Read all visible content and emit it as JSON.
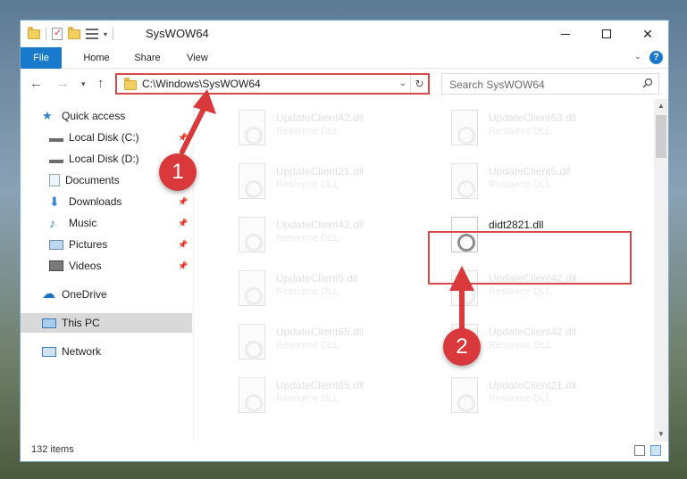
{
  "window": {
    "title": "SysWOW64",
    "caption_buttons": {
      "minimize": "—",
      "maximize": "☐",
      "close": "✕"
    }
  },
  "ribbon": {
    "tabs": [
      "File",
      "Home",
      "Share",
      "View"
    ],
    "help": "?"
  },
  "nav": {
    "address": "C:\\Windows\\SysWOW64",
    "search_placeholder": "Search SysWOW64"
  },
  "sidebar": {
    "items": [
      {
        "label": "Quick access",
        "icon": "star-icon",
        "pinned": false
      },
      {
        "label": "Local Disk (C:)",
        "icon": "drive-icon",
        "pinned": true
      },
      {
        "label": "Local Disk (D:)",
        "icon": "drive-icon",
        "pinned": true
      },
      {
        "label": "Documents",
        "icon": "documents-icon",
        "pinned": true
      },
      {
        "label": "Downloads",
        "icon": "downloads-icon",
        "pinned": true
      },
      {
        "label": "Music",
        "icon": "music-icon",
        "pinned": true
      },
      {
        "label": "Pictures",
        "icon": "pictures-icon",
        "pinned": true
      },
      {
        "label": "Videos",
        "icon": "videos-icon",
        "pinned": true
      },
      {
        "label": "OneDrive",
        "icon": "onedrive-icon",
        "pinned": false
      },
      {
        "label": "This PC",
        "icon": "pc-icon",
        "pinned": false,
        "selected": true
      },
      {
        "label": "Network",
        "icon": "network-icon",
        "pinned": false
      }
    ]
  },
  "files": [
    {
      "name": "UpdateClient42.dll",
      "type": "Resource DLL"
    },
    {
      "name": "UpdateClient63.dll",
      "type": "Resource DLL"
    },
    {
      "name": "UpdateClient21.dll",
      "type": "Resource DLL"
    },
    {
      "name": "UpdateClient5.dll",
      "type": "Resource DLL"
    },
    {
      "name": "UpdateClient42.dll",
      "type": "Resource DLL"
    },
    {
      "name": "didt2821.dll",
      "type": "",
      "highlighted": true
    },
    {
      "name": "UpdateClient5.dll",
      "type": "Resource DLL"
    },
    {
      "name": "UpdateClient42.dll",
      "type": "Resource DLL"
    },
    {
      "name": "UpdateClient65.dll",
      "type": "Resource DLL"
    },
    {
      "name": "UpdateClient42.dll",
      "type": "Resource DLL"
    },
    {
      "name": "UpdateClient65.dll",
      "type": "Resource DLL"
    },
    {
      "name": "UpdateClient21.dll",
      "type": "Resource DLL"
    }
  ],
  "status": {
    "item_count": "132 items"
  },
  "annotations": {
    "step1": "1",
    "step2": "2",
    "color": "#d9393a"
  }
}
